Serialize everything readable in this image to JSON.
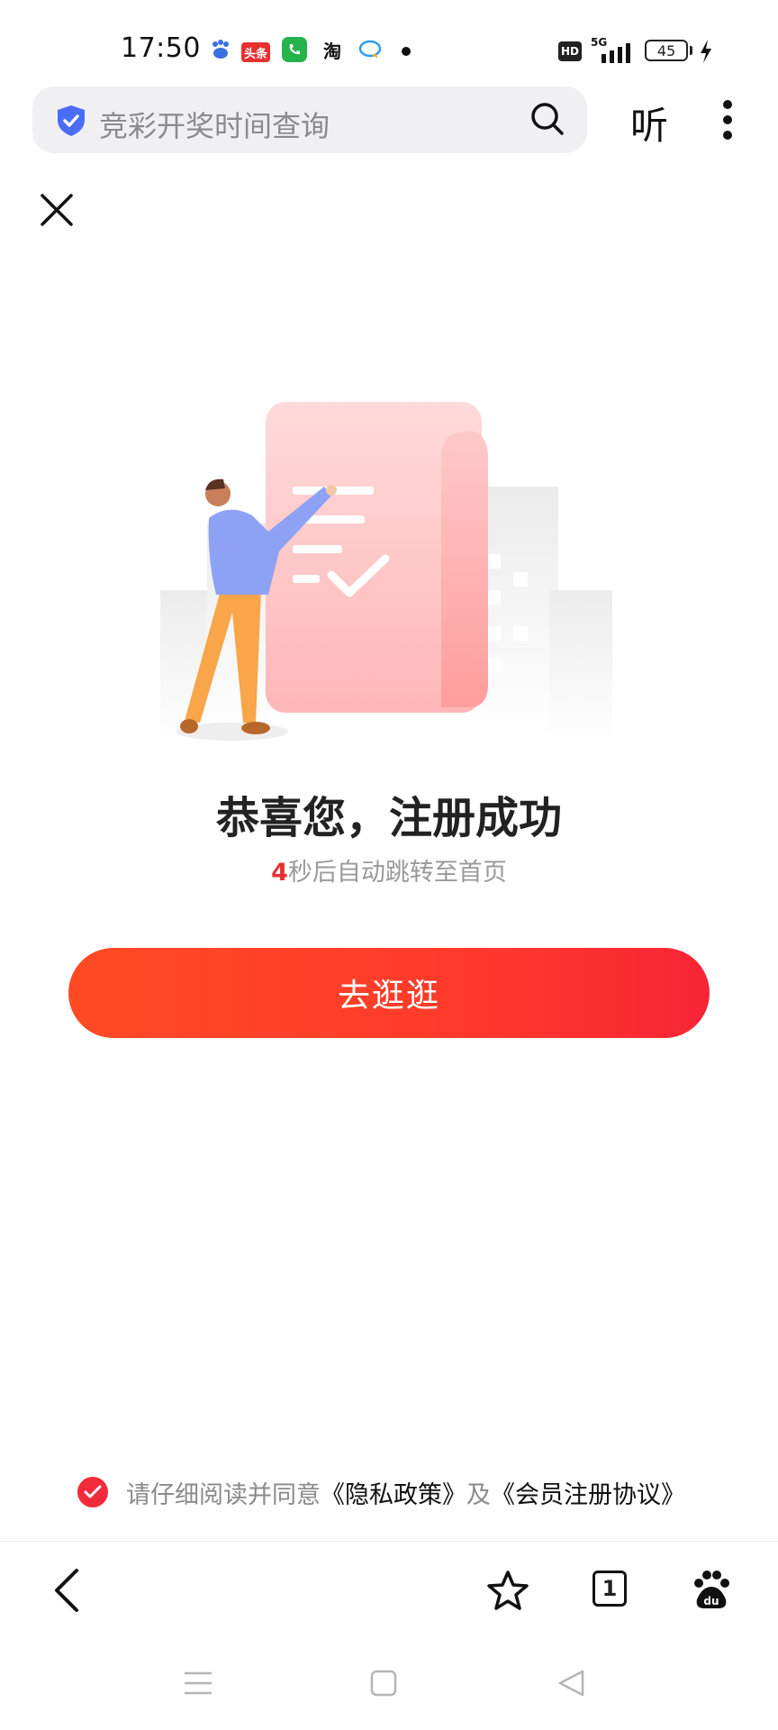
{
  "status_bar": {
    "time": "17:50",
    "notification_icons": [
      "baidu-icon",
      "toutiao-icon",
      "phone-icon",
      "taobao-icon",
      "message-icon"
    ],
    "toutiao_label": "头条",
    "taobao_label": "淘",
    "hd_label": "HD",
    "network_label": "5G",
    "battery": "45"
  },
  "search": {
    "query": "竞彩开奖时间查询",
    "listen_label": "听"
  },
  "main": {
    "title": "恭喜您，注册成功",
    "countdown_number": "4",
    "countdown_text": "秒后自动跳转至首页",
    "button_label": "去逛逛"
  },
  "agreement": {
    "prefix": "请仔细阅读并同意",
    "privacy_link": "《隐私政策》",
    "and": "及",
    "member_link": "《会员注册协议》"
  },
  "toolbar": {
    "tab_count": "1"
  },
  "colors": {
    "accent": "#f12b3a",
    "button_start": "#ff4a24",
    "button_end": "#f72535",
    "shield": "#4a6cf7"
  }
}
